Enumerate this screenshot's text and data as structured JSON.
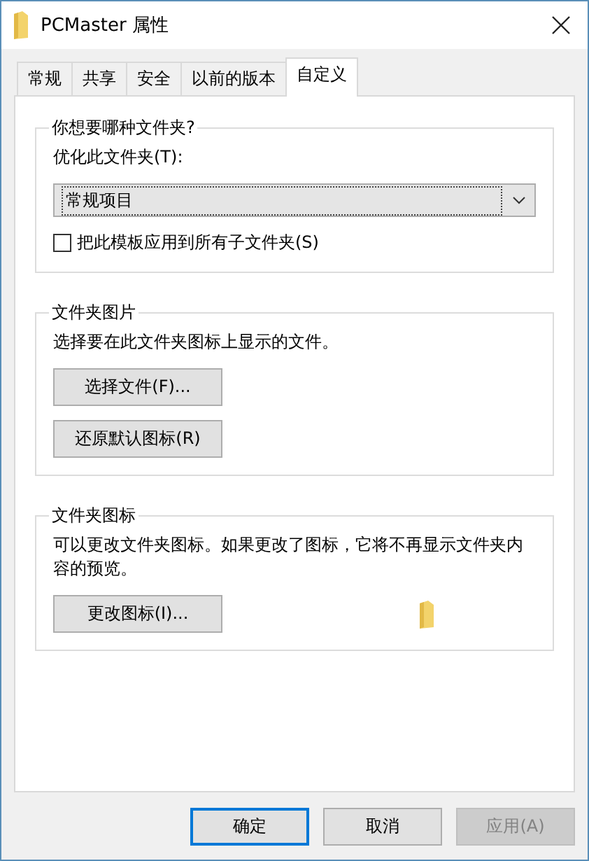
{
  "window": {
    "title": "PCMaster 属性"
  },
  "tabs": [
    {
      "label": "常规",
      "selected": false
    },
    {
      "label": "共享",
      "selected": false
    },
    {
      "label": "安全",
      "selected": false
    },
    {
      "label": "以前的版本",
      "selected": false
    },
    {
      "label": "自定义",
      "selected": true
    }
  ],
  "folder_type": {
    "title": "你想要哪种文件夹?",
    "optimize_label": "优化此文件夹(T):",
    "dropdown_value": "常规项目",
    "apply_to_subfolders": {
      "label": "把此模板应用到所有子文件夹(S)",
      "checked": false
    }
  },
  "folder_pictures": {
    "title": "文件夹图片",
    "description": "选择要在此文件夹图标上显示的文件。",
    "buttons": [
      "选择文件(F)...",
      "还原默认图标(R)"
    ]
  },
  "folder_icons": {
    "title": "文件夹图标",
    "description": "可以更改文件夹图标。如果更改了图标，它将不再显示文件夹内容的预览。",
    "button": "更改图标(I)..."
  },
  "buttons": [
    {
      "label": "确定",
      "disabled": false,
      "default": true
    },
    {
      "label": "取消",
      "disabled": false,
      "default": false
    },
    {
      "label": "应用(A)",
      "disabled": true,
      "default": false
    }
  ]
}
